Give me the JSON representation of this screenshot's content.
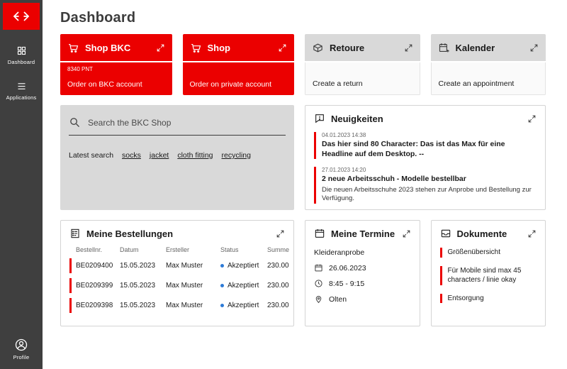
{
  "colors": {
    "brand_red": "#eb0000",
    "sidebar_bg": "#3f3f3f",
    "card_gray": "#d9d9d9",
    "status_blue": "#2e7bd6"
  },
  "sidebar": {
    "logo_icon": "sbb-logo-icon",
    "items": [
      {
        "label": "Dashboard",
        "icon": "dashboard-grid-icon"
      },
      {
        "label": "Applications",
        "icon": "applications-menu-icon"
      }
    ],
    "profile": {
      "label": "Profile",
      "icon": "profile-icon"
    }
  },
  "header": {
    "title": "Dashboard"
  },
  "quick_cards": [
    {
      "title": "Shop BKC",
      "points": "8340 PNT",
      "subtitle": "Order on BKC account",
      "icon": "cart-icon",
      "variant": "red"
    },
    {
      "title": "Shop",
      "subtitle": "Order on private account",
      "icon": "cart-icon",
      "variant": "red"
    },
    {
      "title": "Retoure",
      "subtitle": "Create a return",
      "icon": "return-box-icon",
      "variant": "gray"
    },
    {
      "title": "Kalender",
      "subtitle": "Create an appointment",
      "icon": "calendar-plus-icon",
      "variant": "gray"
    }
  ],
  "search": {
    "placeholder": "Search the BKC Shop",
    "latest_label": "Latest search",
    "tags": [
      "socks",
      "jacket",
      "cloth fitting",
      "recycling"
    ]
  },
  "news": {
    "title": "Neuigkeiten",
    "icon": "news-bubble-icon",
    "items": [
      {
        "timestamp": "04.01.2023  14:38",
        "headline": "Das hier sind 80 Character: Das ist das Max für eine Headline auf dem Desktop. --",
        "body": ""
      },
      {
        "timestamp": "27.01.2023  14:20",
        "headline": "2 neue Arbeitsschuh - Modelle bestellbar",
        "body": "Die neuen Arbeitsschuhe 2023 stehen zur Anprobe und Bestellung zur Verfügung."
      }
    ]
  },
  "orders": {
    "title": "Meine Bestellungen",
    "icon": "order-list-icon",
    "columns": [
      "Bestellnr.",
      "Datum",
      "Ersteller",
      "Status",
      "Summe"
    ],
    "rows": [
      {
        "order_no": "BE0209400",
        "date": "15.05.2023",
        "creator": "Max Muster",
        "status": "Akzeptiert",
        "total": "230.00"
      },
      {
        "order_no": "BE0209399",
        "date": "15.05.2023",
        "creator": "Max Muster",
        "status": "Akzeptiert",
        "total": "230.00"
      },
      {
        "order_no": "BE0209398",
        "date": "15.05.2023",
        "creator": "Max Muster",
        "status": "Akzeptiert",
        "total": "230.00"
      }
    ]
  },
  "appointments": {
    "title": "Meine Termine",
    "icon": "calendar-icon",
    "event_title": "Kleideranprobe",
    "date": "26.06.2023",
    "time": "8:45 - 9:15",
    "location": "Olten"
  },
  "documents": {
    "title": "Dokumente",
    "icon": "document-tray-icon",
    "items": [
      "Größenübersicht",
      "Für Mobile sind max 45 characters / linie okay",
      "Entsorgung"
    ]
  }
}
